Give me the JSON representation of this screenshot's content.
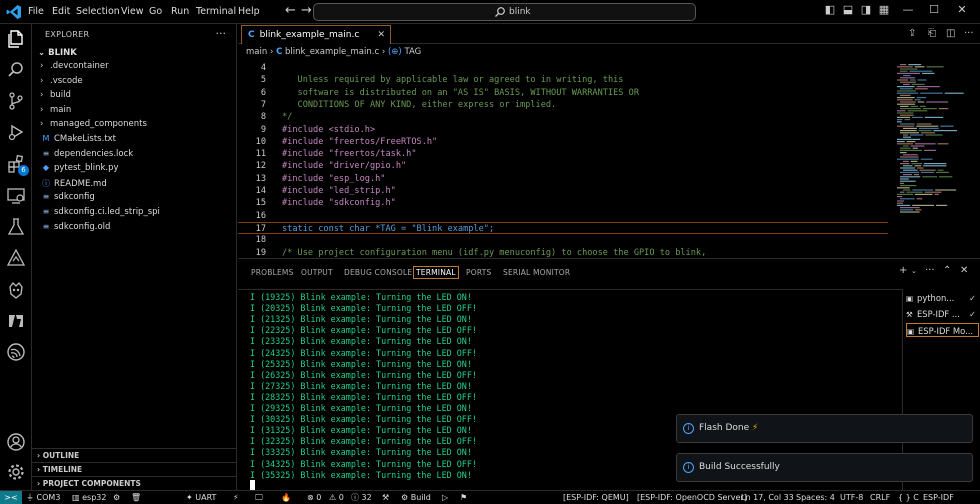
{
  "titlebar": {
    "menu": [
      "File",
      "Edit",
      "Selection",
      "View",
      "Go",
      "Run",
      "Terminal",
      "Help"
    ],
    "search_text": "blink"
  },
  "activity_bar": {
    "icons": [
      "explorer-icon",
      "search-icon",
      "source-control-icon",
      "run-debug-icon",
      "extensions-icon",
      "remote-explorer-icon",
      "testing-icon",
      "esp-idf-icon",
      "platformio-icon",
      "azure-icon",
      "espressif-icon",
      "accounts-icon",
      "manage-icon"
    ],
    "extensions_badge": "6"
  },
  "explorer": {
    "header": "EXPLORER",
    "root": "BLINK",
    "items": [
      {
        "label": ".devcontainer",
        "type": "folder"
      },
      {
        "label": ".vscode",
        "type": "folder"
      },
      {
        "label": "build",
        "type": "folder"
      },
      {
        "label": "main",
        "type": "folder"
      },
      {
        "label": "managed_components",
        "type": "folder"
      },
      {
        "label": "CMakeLists.txt",
        "type": "cmake"
      },
      {
        "label": "dependencies.lock",
        "type": "text"
      },
      {
        "label": "pytest_blink.py",
        "type": "python"
      },
      {
        "label": "README.md",
        "type": "markdown"
      },
      {
        "label": "sdkconfig",
        "type": "text"
      },
      {
        "label": "sdkconfig.ci.led_strip_spi",
        "type": "text"
      },
      {
        "label": "sdkconfig.old",
        "type": "text"
      }
    ],
    "sections": [
      "OUTLINE",
      "TIMELINE",
      "PROJECT COMPONENTS"
    ]
  },
  "editor": {
    "tab": {
      "label": "blink_example_main.c",
      "icon": "C"
    },
    "breadcrumb": {
      "folder": "main",
      "file": "blink_example_main.c",
      "symbol": "TAG"
    },
    "lines": [
      {
        "num": "4",
        "text": ""
      },
      {
        "num": "5",
        "text": "   Unless required by applicable law or agreed to in writing, this"
      },
      {
        "num": "6",
        "text": "   software is distributed on an \"AS IS\" BASIS, WITHOUT WARRANTIES OR"
      },
      {
        "num": "7",
        "text": "   CONDITIONS OF ANY KIND, either express or implied."
      },
      {
        "num": "8",
        "text": "*/"
      },
      {
        "num": "9",
        "text": "#include <stdio.h>"
      },
      {
        "num": "10",
        "text": "#include \"freertos/FreeRTOS.h\""
      },
      {
        "num": "11",
        "text": "#include \"freertos/task.h\""
      },
      {
        "num": "12",
        "text": "#include \"driver/gpio.h\""
      },
      {
        "num": "13",
        "text": "#include \"esp_log.h\""
      },
      {
        "num": "14",
        "text": "#include \"led_strip.h\""
      },
      {
        "num": "15",
        "text": "#include \"sdkconfig.h\""
      },
      {
        "num": "16",
        "text": ""
      },
      {
        "num": "17",
        "text": "static const char *TAG = \"Blink example\";"
      },
      {
        "num": "18",
        "text": ""
      },
      {
        "num": "19",
        "text": "/* Use project configuration menu (idf.py menuconfig) to choose the GPIO to blink,"
      }
    ]
  },
  "panel": {
    "tabs": [
      "PROBLEMS",
      "OUTPUT",
      "DEBUG CONSOLE",
      "TERMINAL",
      "PORTS",
      "SERIAL MONITOR"
    ],
    "active_tab": "TERMINAL",
    "terminal_lines": [
      "I (19325) Blink example: Turning the LED ON!",
      "I (20325) Blink example: Turning the LED OFF!",
      "I (21325) Blink example: Turning the LED ON!",
      "I (22325) Blink example: Turning the LED OFF!",
      "I (23325) Blink example: Turning the LED ON!",
      "I (24325) Blink example: Turning the LED OFF!",
      "I (25325) Blink example: Turning the LED ON!",
      "I (26325) Blink example: Turning the LED OFF!",
      "I (27325) Blink example: Turning the LED ON!",
      "I (28325) Blink example: Turning the LED OFF!",
      "I (29325) Blink example: Turning the LED ON!",
      "I (30325) Blink example: Turning the LED OFF!",
      "I (31325) Blink example: Turning the LED ON!",
      "I (32325) Blink example: Turning the LED OFF!",
      "I (33325) Blink example: Turning the LED ON!",
      "I (34325) Blink example: Turning the LED OFF!",
      "I (35325) Blink example: Turning the LED ON!"
    ],
    "terminals": [
      {
        "label": "python...",
        "icon": "terminal-icon",
        "check": true
      },
      {
        "label": "ESP-IDF ...",
        "icon": "tools-icon",
        "check": true
      },
      {
        "label": "ESP-IDF Mo...",
        "icon": "terminal-icon",
        "check": false
      }
    ]
  },
  "notifications": [
    {
      "text": "Flash Done",
      "emoji": "⚡"
    },
    {
      "text": "Build Successfully",
      "emoji": ""
    }
  ],
  "statusbar": {
    "remote": "><",
    "items_left": [
      {
        "icon": "plug-icon",
        "label": "COM3"
      },
      {
        "icon": "chip-icon",
        "label": "esp32"
      },
      {
        "icon": "gear-icon",
        "label": ""
      },
      {
        "icon": "trash-icon",
        "label": ""
      },
      {
        "icon": "star-icon",
        "label": "UART"
      },
      {
        "icon": "flash-icon",
        "label": ""
      },
      {
        "icon": "monitor-icon",
        "label": ""
      },
      {
        "icon": "fire-icon",
        "label": ""
      },
      {
        "icon": "error-icon",
        "label": "0"
      },
      {
        "icon": "warning-icon",
        "label": "0"
      },
      {
        "icon": "info-icon",
        "label": "32"
      },
      {
        "icon": "wrench-icon",
        "label": ""
      },
      {
        "icon": "build-icon",
        "label": "Build"
      },
      {
        "icon": "run-icon",
        "label": ""
      },
      {
        "icon": "debug-icon",
        "label": ""
      }
    ],
    "items_right": [
      "[ESP-IDF: QEMU]",
      "[ESP-IDF: OpenOCD Server]",
      "Ln 17, Col 33",
      "Spaces: 4",
      "UTF-8",
      "CRLF",
      "{ } C",
      "ESP-IDF"
    ]
  }
}
